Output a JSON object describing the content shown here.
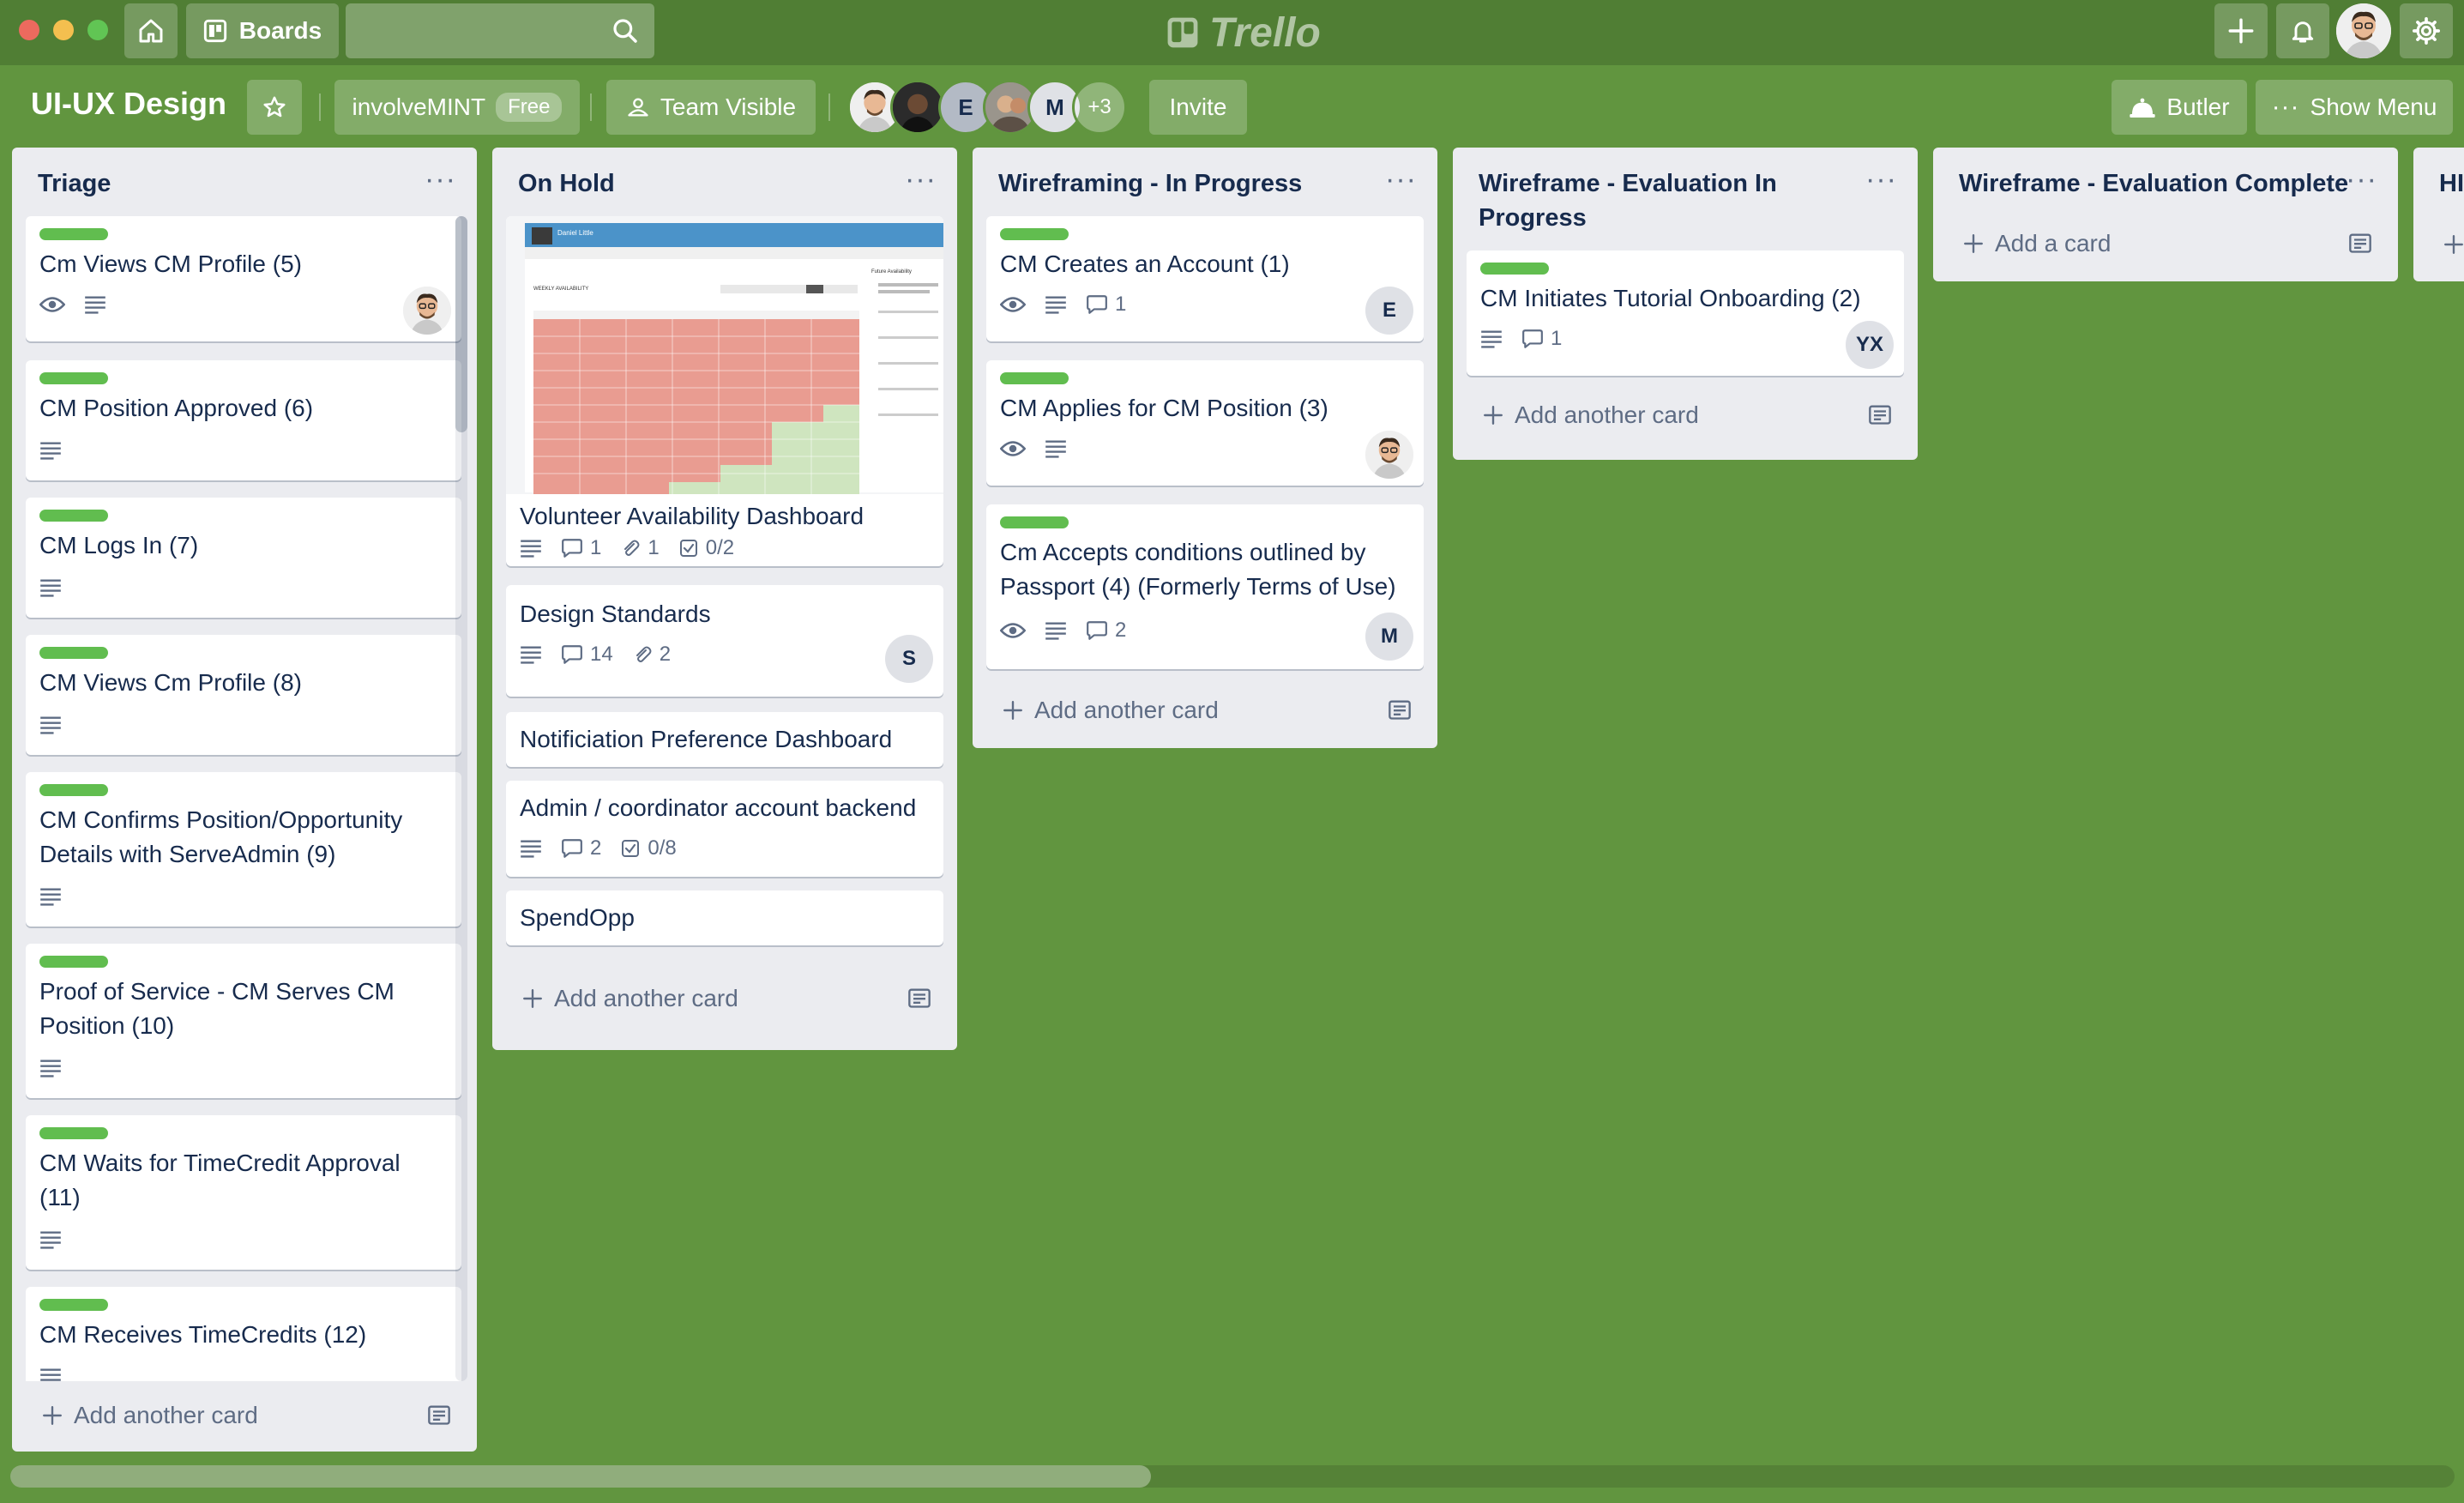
{
  "topbar": {
    "boards_label": "Boards",
    "search_value": "",
    "logo_text": "Trello"
  },
  "board": {
    "title": "UI-UX Design",
    "team_name": "involveMINT",
    "team_badge": "Free",
    "visibility": "Team Visible",
    "member_initials": [
      "E",
      "M"
    ],
    "members_more": "+3",
    "invite_label": "Invite",
    "butler_label": "Butler",
    "menu_label": "Show Menu"
  },
  "lists": [
    {
      "title": "Triage",
      "menu": "···",
      "cards": [
        {
          "title": "Cm Views CM Profile (5)",
          "badges": {
            "watch": true,
            "description": true
          }
        },
        {
          "title": "CM Position Approved (6)"
        },
        {
          "title": "CM Logs In (7)"
        },
        {
          "title": "CM Views Cm Profile (8)"
        },
        {
          "title": "CM Confirms Position/Opportunity Details with ServeAdmin (9)"
        },
        {
          "title": "Proof of Service - CM Serves CM Position (10)"
        },
        {
          "title": "CM Waits for TimeCredit Approval (11)"
        },
        {
          "title": "CM Receives TimeCredits (12)"
        }
      ],
      "add_label": "Add another card"
    },
    {
      "title": "On Hold",
      "menu": "···",
      "cards": [
        {
          "title": "Volunteer Availability Dashboard",
          "comments": "1",
          "attachments": "1",
          "checklist": "0/2"
        },
        {
          "title": "Design Standards",
          "comments": "14",
          "attachments": "2",
          "member": "S"
        },
        {
          "title": "Notificiation Preference Dashboard"
        },
        {
          "title": "Admin / coordinator account backend",
          "comments": "2",
          "checklist": "0/8"
        },
        {
          "title": "SpendOpp"
        }
      ],
      "add_label": "Add another card"
    },
    {
      "title": "Wireframing - In Progress",
      "menu": "···",
      "cards": [
        {
          "title": "CM Creates an Account (1)",
          "comments": "1",
          "member": "E"
        },
        {
          "title": "CM Applies for CM Position (3)"
        },
        {
          "title": "Cm Accepts conditions outlined by Passport (4) (Formerly Terms of Use)",
          "comments": "2",
          "member": "M"
        }
      ],
      "add_label": "Add another card"
    },
    {
      "title": "Wireframe - Evaluation In Progress",
      "menu": "···",
      "cards": [
        {
          "title": "CM Initiates Tutorial Onboarding (2)",
          "comments": "1",
          "member": "YX"
        }
      ],
      "add_label": "Add another card"
    },
    {
      "title": "Wireframe - Evaluation Complete",
      "menu": "···",
      "cards": [],
      "add_label": "Add a card"
    },
    {
      "title": "HI",
      "cards": []
    }
  ],
  "mockup": {
    "profile_name": "Daniel Little",
    "section_title": "WEEKLY AVAILABILITY",
    "side_title": "Future Availability"
  },
  "colors": {
    "board_bg": "#61953f",
    "topbar_bg": "#507e34",
    "label_green": "#61bd4f",
    "list_bg": "#ebecf0"
  }
}
